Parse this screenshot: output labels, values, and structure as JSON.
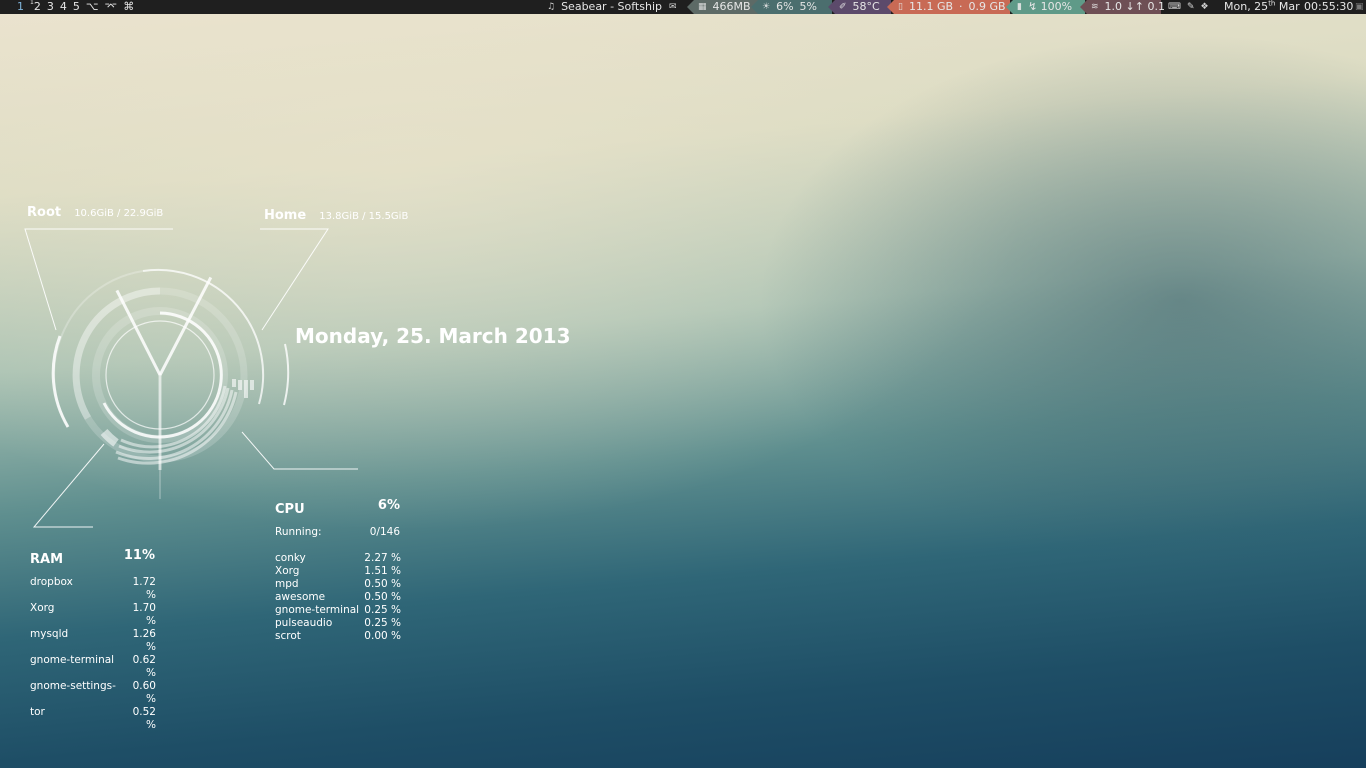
{
  "topbar": {
    "tags": [
      {
        "label": "1",
        "active": true
      },
      {
        "label": "2",
        "sup": "1"
      },
      {
        "label": "3"
      },
      {
        "label": "4"
      },
      {
        "label": "5"
      },
      {
        "label": "⌥"
      },
      {
        "label": "⌤"
      },
      {
        "label": "⌘"
      }
    ],
    "now_playing": "Seabear - Softship",
    "memory": "466MB",
    "cpu_a": "6%",
    "cpu_b": "5%",
    "temp": "58°C",
    "disk_a": "11.1 GB",
    "disk_sep": "·",
    "disk_b": "0.9 GB",
    "battery": "↯ 100%",
    "network": "1.0 ↓↑ 0.1",
    "date": "Mon, 25",
    "date_sup": "th",
    "date_month": "Mar",
    "time": "00:55:30",
    "colors": {
      "bar_bg": "#1f1f1f",
      "mem": "#5d6a66",
      "cpu": "#4b6e6e",
      "temp": "#5c4a6b",
      "disk": "#c86a55",
      "bat": "#5f9a88",
      "net": "#6e4f55"
    }
  },
  "conky": {
    "root_label": "Root",
    "root_value": "10.6GiB / 22.9GiB",
    "home_label": "Home",
    "home_value": "13.8GiB / 15.5GiB",
    "date": "Monday, 25. March 2013",
    "clock": {
      "hour": 0,
      "minute": 55,
      "second": 30
    },
    "ram": {
      "title": "RAM",
      "percent": "11%",
      "procs": [
        {
          "name": "dropbox",
          "value": "1.72 %"
        },
        {
          "name": "Xorg",
          "value": "1.70 %"
        },
        {
          "name": "mysqld",
          "value": "1.26 %"
        },
        {
          "name": "gnome-terminal",
          "value": "0.62 %"
        },
        {
          "name": "gnome-settings-",
          "value": "0.60 %"
        },
        {
          "name": "tor",
          "value": "0.52 %"
        }
      ]
    },
    "cpu": {
      "title": "CPU",
      "percent": "6%",
      "running_label": "Running:",
      "running_value": "0/146",
      "procs": [
        {
          "name": "conky",
          "value": "2.27 %"
        },
        {
          "name": "Xorg",
          "value": "1.51 %"
        },
        {
          "name": "mpd",
          "value": "0.50 %"
        },
        {
          "name": "awesome",
          "value": "0.50 %"
        },
        {
          "name": "gnome-terminal",
          "value": "0.25 %"
        },
        {
          "name": "pulseaudio",
          "value": "0.25 %"
        },
        {
          "name": "scrot",
          "value": "0.00 %"
        }
      ]
    }
  }
}
